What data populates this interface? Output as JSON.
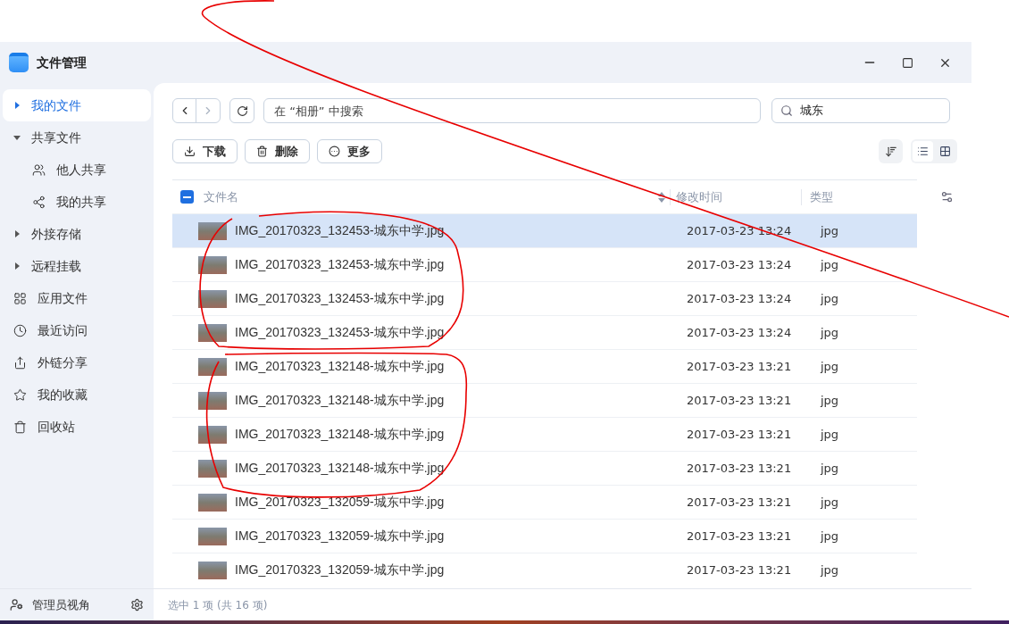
{
  "window": {
    "title": "文件管理"
  },
  "sidebar": {
    "items": [
      {
        "kind": "folder",
        "label": "我的文件",
        "selected": true,
        "expanded": false
      },
      {
        "kind": "folder",
        "label": "共享文件",
        "selected": false,
        "expanded": true,
        "children": [
          {
            "kind": "people",
            "label": "他人共享",
            "selected": false
          },
          {
            "kind": "share",
            "label": "我的共享",
            "selected": false
          }
        ]
      },
      {
        "kind": "folder",
        "label": "外接存储",
        "selected": false,
        "expanded": false
      },
      {
        "kind": "folder",
        "label": "远程挂载",
        "selected": false,
        "expanded": false
      },
      {
        "kind": "apps",
        "label": "应用文件",
        "selected": false
      },
      {
        "kind": "clock",
        "label": "最近访问",
        "selected": false
      },
      {
        "kind": "export",
        "label": "外链分享",
        "selected": false
      },
      {
        "kind": "star",
        "label": "我的收藏",
        "selected": false
      },
      {
        "kind": "trash",
        "label": "回收站",
        "selected": false
      }
    ],
    "footer": {
      "label": "管理员视角"
    }
  },
  "toolbar": {
    "back": {
      "disabled": false
    },
    "forward": {
      "disabled": true
    },
    "path_search": {
      "placeholder": "在 “相册” 中搜索"
    },
    "search": {
      "value": "城东"
    },
    "actions": [
      {
        "kind": "download",
        "label": "下载"
      },
      {
        "kind": "delete",
        "label": "删除"
      },
      {
        "kind": "more",
        "label": "更多"
      }
    ],
    "view_modes": [
      {
        "kind": "list",
        "selected": true
      },
      {
        "kind": "grid",
        "selected": false
      }
    ]
  },
  "table": {
    "select_all": {
      "indeterminate": true
    },
    "columns": [
      "文件名",
      "修改时间",
      "类型"
    ],
    "rows": [
      {
        "name": "IMG_20170323_132453-城东中学.jpg",
        "modified": "2017-03-23 13:24",
        "type": "jpg",
        "selected": true
      },
      {
        "name": "IMG_20170323_132453-城东中学.jpg",
        "modified": "2017-03-23 13:24",
        "type": "jpg",
        "selected": false
      },
      {
        "name": "IMG_20170323_132453-城东中学.jpg",
        "modified": "2017-03-23 13:24",
        "type": "jpg",
        "selected": false
      },
      {
        "name": "IMG_20170323_132453-城东中学.jpg",
        "modified": "2017-03-23 13:24",
        "type": "jpg",
        "selected": false
      },
      {
        "name": "IMG_20170323_132148-城东中学.jpg",
        "modified": "2017-03-23 13:21",
        "type": "jpg",
        "selected": false
      },
      {
        "name": "IMG_20170323_132148-城东中学.jpg",
        "modified": "2017-03-23 13:21",
        "type": "jpg",
        "selected": false
      },
      {
        "name": "IMG_20170323_132148-城东中学.jpg",
        "modified": "2017-03-23 13:21",
        "type": "jpg",
        "selected": false
      },
      {
        "name": "IMG_20170323_132148-城东中学.jpg",
        "modified": "2017-03-23 13:21",
        "type": "jpg",
        "selected": false
      },
      {
        "name": "IMG_20170323_132059-城东中学.jpg",
        "modified": "2017-03-23 13:21",
        "type": "jpg",
        "selected": false
      },
      {
        "name": "IMG_20170323_132059-城东中学.jpg",
        "modified": "2017-03-23 13:21",
        "type": "jpg",
        "selected": false
      },
      {
        "name": "IMG_20170323_132059-城东中学.jpg",
        "modified": "2017-03-23 13:21",
        "type": "jpg",
        "selected": false
      }
    ]
  },
  "status_bar": {
    "text": "选中 1 项 (共 16 项)"
  }
}
